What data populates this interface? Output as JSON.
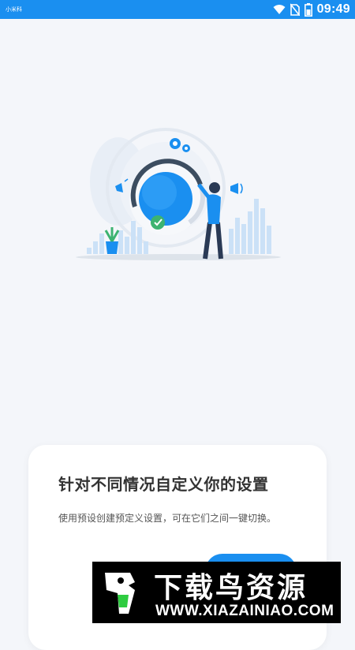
{
  "status_bar": {
    "carrier": "小米科",
    "time": "09:49",
    "icons": [
      "wifi-icon",
      "no-sim-icon",
      "battery-icon"
    ],
    "background": "#1a8ff0"
  },
  "illustration": {
    "name": "preset-settings-illustration",
    "accent": "#1a8ff0"
  },
  "card": {
    "title": "针对不同情况自定义你的设置",
    "description": "使用预设创建预定义设置，可在它们之间一键切换。"
  },
  "watermark": {
    "title": "下载鸟资源",
    "url": "WWW.XIAZAINIAO.COM"
  }
}
